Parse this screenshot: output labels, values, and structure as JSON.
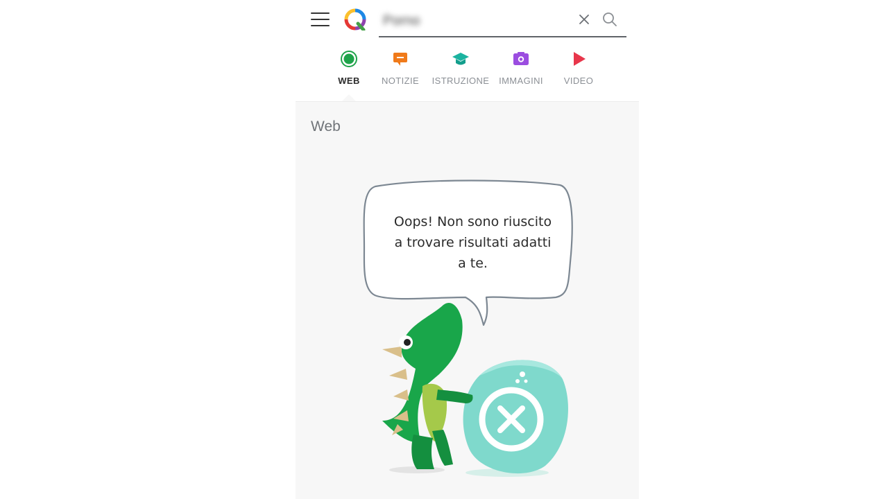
{
  "header": {
    "menu_icon": "hamburger-menu-icon",
    "logo_icon": "qwant-q-logo-icon",
    "search": {
      "value": "Porno",
      "placeholder": ""
    },
    "clear_icon": "close-x-icon",
    "search_icon": "magnifier-icon"
  },
  "tabs": [
    {
      "label": "WEB",
      "icon": "web-circle-icon",
      "color": "#1fa34a",
      "active": true
    },
    {
      "label": "NOTIZIE",
      "icon": "news-speech-icon",
      "color": "#f07a1a",
      "active": false
    },
    {
      "label": "ISTRUZIONE",
      "icon": "graduation-cap-icon",
      "color": "#1bb3a0",
      "active": false
    },
    {
      "label": "IMMAGINI",
      "icon": "camera-icon",
      "color": "#9b4de0",
      "active": false
    },
    {
      "label": "VIDEO",
      "icon": "play-icon",
      "color": "#e8364b",
      "active": false
    }
  ],
  "content": {
    "section_title": "Web",
    "message_line1": "Oops! Non sono riuscito",
    "message_line2": "a trovare risultati adatti",
    "message_line3": "a te.",
    "illustration": "dinosaur-with-no-results-stone"
  },
  "colors": {
    "accent_green": "#1fa34a",
    "dino_green": "#17a34a",
    "stone_teal": "#7fd9cc",
    "background": "#f7f7f7"
  }
}
